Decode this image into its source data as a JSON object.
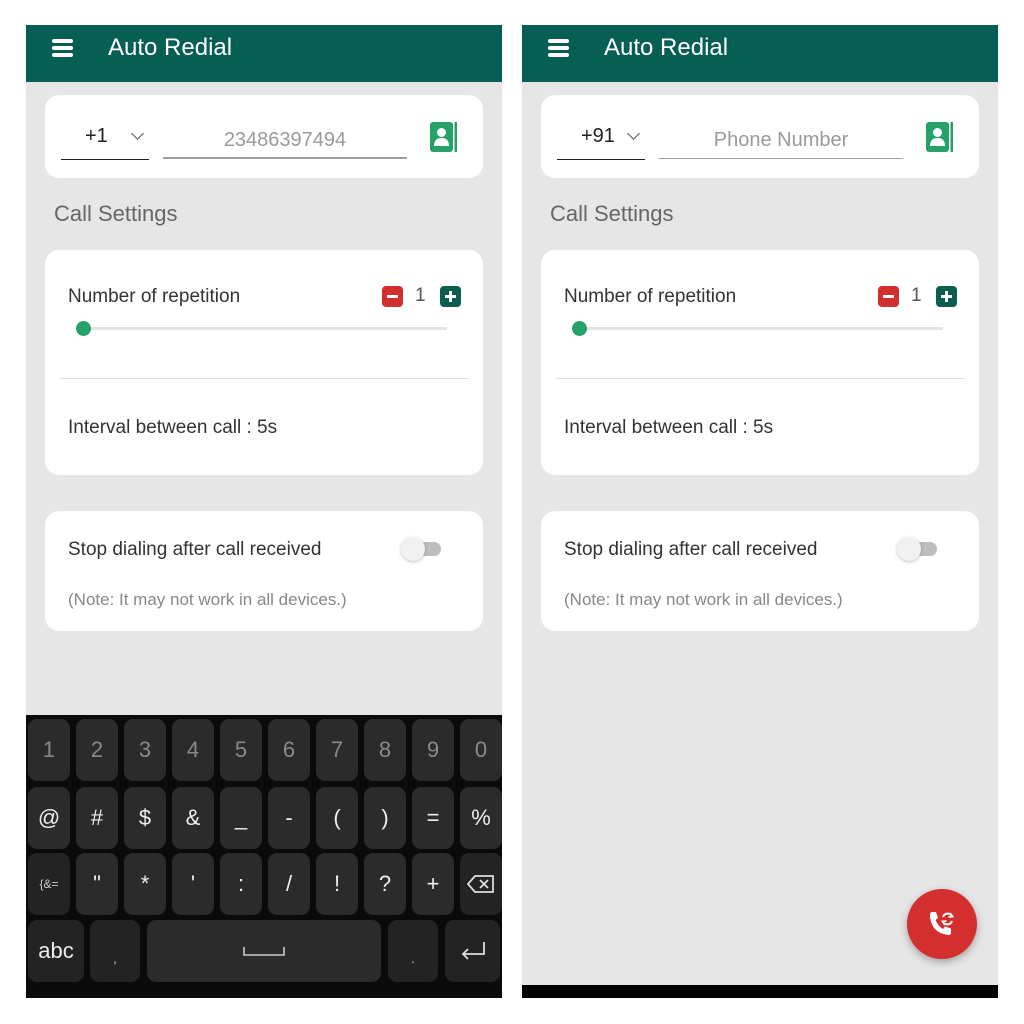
{
  "screens": [
    {
      "app_title": "Auto Redial",
      "menu_icon": "hamburger-menu-icon",
      "country_code": "+1",
      "phone_number_value": "23486397494",
      "phone_number_placeholder": "Phone Number",
      "contacts_icon": "contact-book-icon",
      "section_title": "Call Settings",
      "repetition_label": "Number of repetition",
      "repetition_value": "1",
      "repetition_slider_fraction": 0,
      "interval_text": "Interval between call : 5s",
      "stop_dialing_label": "Stop dialing after call received",
      "stop_dialing_enabled": false,
      "note_text": "(Note: It may not work in all devices.)",
      "keyboard_visible": true
    },
    {
      "app_title": "Auto Redial",
      "menu_icon": "hamburger-menu-icon",
      "country_code": "+91",
      "phone_number_value": "",
      "phone_number_placeholder": "Phone Number",
      "contacts_icon": "contact-book-icon",
      "section_title": "Call Settings",
      "repetition_label": "Number of repetition",
      "repetition_value": "1",
      "repetition_slider_fraction": 0,
      "interval_text": "Interval between call : 5s",
      "stop_dialing_label": "Stop dialing after call received",
      "stop_dialing_enabled": false,
      "note_text": "(Note: It may not work in all devices.)",
      "fab_icon": "redial-phone-icon"
    }
  ],
  "keyboard": {
    "rows": [
      [
        "1",
        "2",
        "3",
        "4",
        "5",
        "6",
        "7",
        "8",
        "9",
        "0"
      ],
      [
        "@",
        "#",
        "$",
        "&",
        "_",
        "-",
        "(",
        ")",
        "=",
        "%"
      ],
      [
        "{&=",
        "\"",
        "*",
        "'",
        ":",
        "/",
        "!",
        "?",
        "+",
        "backspace"
      ],
      [
        "abc",
        ",",
        "space",
        ".",
        "enter"
      ]
    ]
  },
  "colors": {
    "appbar": "#075e54",
    "accent_green": "#26a269",
    "minus_red": "#d32f2f",
    "plus_green": "#0b5e50",
    "fab_red": "#d32f2f",
    "background": "#e6e6e6"
  }
}
